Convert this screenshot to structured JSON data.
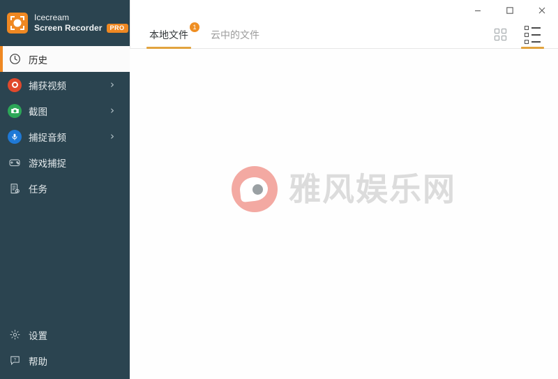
{
  "brand": {
    "logo_icon": "record-frame-icon",
    "line1": "Icecream",
    "line2": "Screen Recorder",
    "pro_label": "PRO"
  },
  "sidebar": {
    "background_color": "#2b4450",
    "accent_color": "#ef8822",
    "items": [
      {
        "label": "历史",
        "icon": "clock-icon",
        "active": true,
        "expandable": false
      },
      {
        "label": "捕获视频",
        "icon": "record-icon",
        "active": false,
        "expandable": true
      },
      {
        "label": "截图",
        "icon": "camera-icon",
        "active": false,
        "expandable": true
      },
      {
        "label": "捕捉音频",
        "icon": "microphone-icon",
        "active": false,
        "expandable": true
      },
      {
        "label": "游戏捕捉",
        "icon": "gamepad-icon",
        "active": false,
        "expandable": false
      },
      {
        "label": "任务",
        "icon": "tasks-icon",
        "active": false,
        "expandable": false
      }
    ],
    "bottom_items": [
      {
        "label": "设置",
        "icon": "gear-icon"
      },
      {
        "label": "帮助",
        "icon": "help-icon"
      }
    ],
    "chevron_glyph": "›"
  },
  "titlebar": {
    "minimize_label": "minimize-icon",
    "maximize_label": "maximize-icon",
    "close_label": "close-icon"
  },
  "toolbar": {
    "tabs": [
      {
        "label": "本地文件",
        "active": true,
        "badge": "1"
      },
      {
        "label": "云中的文件",
        "active": false,
        "badge": ""
      }
    ],
    "views": [
      {
        "name": "grid-view",
        "active": false
      },
      {
        "name": "list-view",
        "active": true
      }
    ],
    "active_underline_color": "#e2a33e"
  },
  "content": {
    "watermark_text": "雅风娱乐网",
    "watermark_color": "#dcdcdc",
    "watermark_logo_color": "#f3a9a2",
    "empty": true
  }
}
